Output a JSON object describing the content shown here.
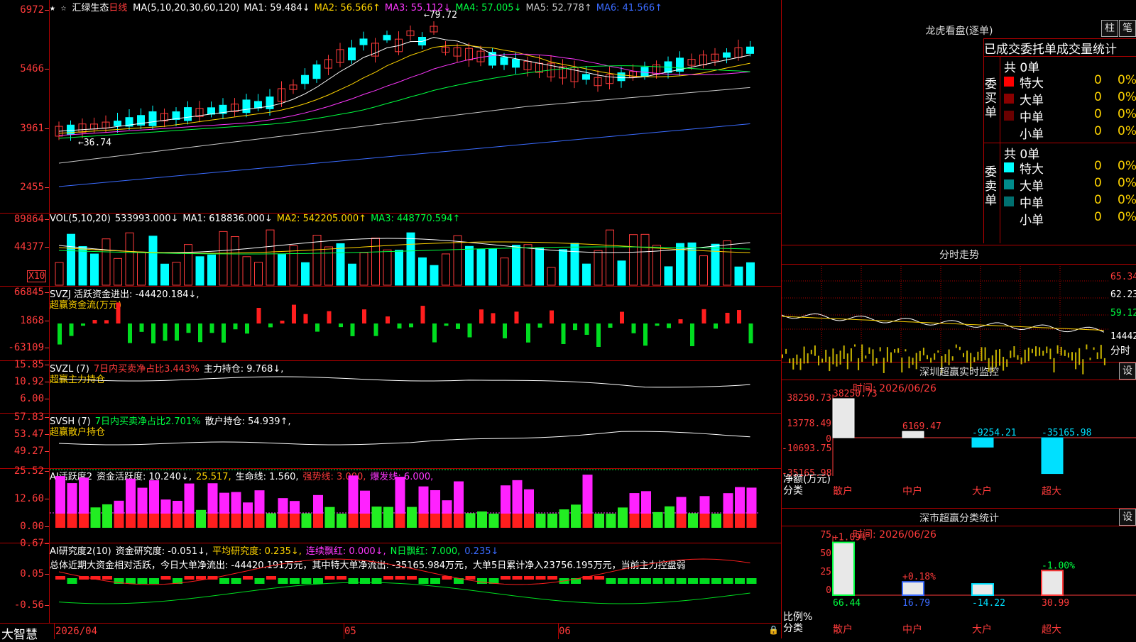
{
  "stock": {
    "name": "汇绿生态",
    "period": "日线",
    "ma_header": [
      {
        "label": "MA(5,10,20,30,60,120)",
        "color": "#ffffff"
      },
      {
        "label": "MA1: 59.484↓",
        "color": "#ffffff"
      },
      {
        "label": "MA2: 56.566↑",
        "color": "#ffd400"
      },
      {
        "label": "MA3: 55.112↓",
        "color": "#ff37ff"
      },
      {
        "label": "MA4: 57.005↓",
        "color": "#00ff40"
      },
      {
        "label": "MA5: 52.778↑",
        "color": "#c8c8c8"
      },
      {
        "label": "MA6: 41.566↑",
        "color": "#3a6bff"
      }
    ],
    "price_axis": [
      "6972",
      "5466",
      "3961",
      "2455"
    ],
    "high_label": "79.72",
    "low_label": "36.74"
  },
  "volume": {
    "header": [
      {
        "label": "VOL(5,10,20)",
        "color": "#ffffff"
      },
      {
        "label": "533993.000↓",
        "color": "#ffffff"
      },
      {
        "label": "MA1: 618836.000↓",
        "color": "#ffffff"
      },
      {
        "label": "MA2: 542205.000↑",
        "color": "#ffd400"
      },
      {
        "label": "MA3: 448770.594↑",
        "color": "#00ff40"
      }
    ],
    "axis": [
      "89864",
      "44377"
    ],
    "unit": "X10"
  },
  "svzj": {
    "header_line1": [
      {
        "label": "SVZJ  活跃资金进出: -44420.184↓,",
        "color": "#ffffff"
      }
    ],
    "header_line2": "超赢资金流(万元)",
    "axis": [
      "66845",
      "1868",
      "-63109"
    ]
  },
  "svzl": {
    "header_line1": [
      {
        "label": "SVZL (7)",
        "color": "#ffffff"
      },
      {
        "label": "7日内买卖净占比3.443%",
        "color": "#ff3b3b"
      },
      {
        "label": "主力持仓: 9.768↓,",
        "color": "#ffffff"
      }
    ],
    "header_line2": "超赢主力持仓",
    "axis": [
      "15.85",
      "10.92",
      "6.00"
    ]
  },
  "svsh": {
    "header_line1": [
      {
        "label": "SVSH (7)",
        "color": "#ffffff"
      },
      {
        "label": "7日内买卖净占比2.701%",
        "color": "#00ff40"
      },
      {
        "label": "散户持仓: 54.939↑,",
        "color": "#ffffff"
      }
    ],
    "header_line2": "超赢散户持仓",
    "axis": [
      "57.83",
      "53.47",
      "49.27"
    ]
  },
  "ai_active": {
    "header": [
      {
        "label": "AI活跃度2",
        "color": "#ffffff"
      },
      {
        "label": "资金活跃度: 10.240↓,",
        "color": "#ffffff"
      },
      {
        "label": "25.517,",
        "color": "#ffd400"
      },
      {
        "label": "生命线: 1.560,",
        "color": "#ffffff"
      },
      {
        "label": "强势线: 3.000,",
        "color": "#ff3b3b"
      },
      {
        "label": "爆发线: 6.000,",
        "color": "#ff37ff"
      }
    ],
    "axis": [
      "25.52",
      "12.60",
      "0.00"
    ]
  },
  "ai_research": {
    "header": [
      {
        "label": "AI研究度2(10)",
        "color": "#ffffff"
      },
      {
        "label": "资金研究度: -0.051↓,",
        "color": "#ffffff"
      },
      {
        "label": "平均研究度: 0.235↓,",
        "color": "#ffd400"
      },
      {
        "label": "连续飘红: 0.000↓,",
        "color": "#ff37ff"
      },
      {
        "label": "N日飘红: 7.000,",
        "color": "#00ff40"
      },
      {
        "label": "0.235↓",
        "color": "#3a6bff"
      }
    ],
    "summary": "总体近期大资金相对活跃，今日大单净流出: -44420.191万元，其中特大单净流出: -35165.984万元，大单5日累计净入23756.195万元，当前主力控盘弱",
    "axis": [
      "0.67",
      "0.05",
      "-0.56"
    ]
  },
  "x_axis": {
    "brand": "大智慧",
    "labels": [
      "2026/04",
      "05",
      "06"
    ]
  },
  "dragon_tiger": {
    "title": "龙虎看盘(逐单)",
    "btn1": "柱",
    "btn2": "笔",
    "tabs": "已成交委托单成交量统计",
    "buy_group": "委买单",
    "sell_group": "委卖单",
    "buy_total": "共 0单",
    "sell_total": "共 0单",
    "buy_rows": [
      {
        "label": "特大",
        "count": "0",
        "pct": "0%",
        "color": "#ff0000"
      },
      {
        "label": "大单",
        "count": "0",
        "pct": "0%",
        "color": "#8b0000"
      },
      {
        "label": "中单",
        "count": "0",
        "pct": "0%",
        "color": "#6b0000"
      },
      {
        "label": "小单",
        "count": "0",
        "pct": "0%",
        "color": "#000000"
      }
    ],
    "sell_rows": [
      {
        "label": "特大",
        "count": "0",
        "pct": "0%",
        "color": "#00ffff"
      },
      {
        "label": "大单",
        "count": "0",
        "pct": "0%",
        "color": "#008b8b"
      },
      {
        "label": "中单",
        "count": "0",
        "pct": "0%",
        "color": "#007070"
      },
      {
        "label": "小单",
        "count": "0",
        "pct": "0%",
        "color": "#000000"
      }
    ]
  },
  "intraday": {
    "title": "分时走势",
    "axis": [
      "65.34",
      "62.23",
      "59.12",
      "14442"
    ],
    "unit": "分时"
  },
  "sz_monitor": {
    "title": "深圳超赢实时监控",
    "set": "设",
    "time": "时间: 2026/06/26",
    "axis": [
      "38250.73",
      "13778.49",
      "0",
      "-10693.75",
      "-35165.98"
    ],
    "axis_title": "净额(万元)",
    "cat_title": "分类",
    "bars": [
      {
        "label": "散户",
        "value": "38250.73",
        "color": "#ff3b3b"
      },
      {
        "label": "中户",
        "value": "6169.47",
        "color": "#ff3b3b"
      },
      {
        "label": "大户",
        "value": "-9254.21",
        "color": "#00e0ff"
      },
      {
        "label": "超大",
        "value": "-35165.98",
        "color": "#00e0ff"
      }
    ]
  },
  "sz_classify": {
    "title": "深市超赢分类统计",
    "set": "设",
    "time": "时间: 2026/06/26",
    "axis": [
      "75",
      "50",
      "25",
      "0"
    ],
    "axis_title": "比例%",
    "cat_title": "分类",
    "bars": [
      {
        "label": "散户",
        "top": "+1.09%",
        "bottom": "66.44",
        "top_color": "#ff3b3b",
        "bottom_color": "#00ff40"
      },
      {
        "label": "中户",
        "top": "+0.18%",
        "bottom": "16.79",
        "top_color": "#ff3b3b",
        "bottom_color": "#3a6bff"
      },
      {
        "label": "大户",
        "top": "",
        "bottom": "-14.22",
        "top_color": "#ff3b3b",
        "bottom_color": "#00e0ff"
      },
      {
        "label": "超大",
        "top": "-1.00%",
        "bottom": "30.99",
        "top_color": "#00ff40",
        "bottom_color": "#ff3b3b"
      }
    ]
  }
}
